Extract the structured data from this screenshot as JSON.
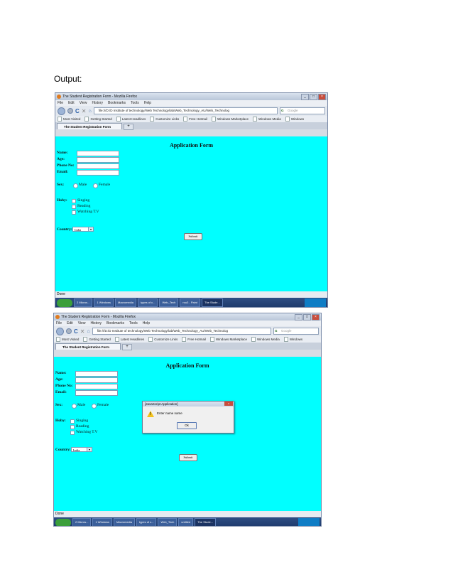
{
  "doc": {
    "label": "Output:"
  },
  "browser": {
    "window_title": "The Student Registration Form - Mozilla Firefox",
    "menu": [
      "File",
      "Edit",
      "View",
      "History",
      "Bookmarks",
      "Tools",
      "Help"
    ],
    "url": "file:///D:/D Institute of technology/Web Technology/lab/Web_Technology_AU/Web_Technolog",
    "search_placeholder": "Google",
    "bookmarks": [
      "Most Visited",
      "Getting Started",
      "Latest Headlines",
      "Customize Links",
      "Free Hotmail",
      "Windows Marketplace",
      "Windows Media",
      "Windows"
    ],
    "tab_title": "The Student Registration Form",
    "status": "Done",
    "taskbar1": [
      "2 Micros...",
      "1 Windows",
      "Macromedia",
      "types of c...",
      "Web_Tech",
      "rou3 - Paint",
      "The Stude..."
    ],
    "taskbar2": [
      "2 Micros...",
      "1 Windows",
      "Macromedia",
      "types of c...",
      "Web_Tech",
      "untitled",
      "The Stude..."
    ]
  },
  "form": {
    "heading": "Application Form",
    "labels": {
      "name": "Name:",
      "age": "Age:",
      "phone": "Phone No:",
      "email": "Email:",
      "sex": "Sex:",
      "hobby": "Hoby:",
      "country": "Country:"
    },
    "sex_options": [
      "Male",
      "Female"
    ],
    "hobbies": [
      "Singing",
      "Reading",
      "Watching T.V"
    ],
    "country_value": "India",
    "submit_label": "Submit"
  },
  "dialog": {
    "title": "[JavaScript Application]",
    "message": "Enter name name",
    "ok_label": "Ok"
  }
}
